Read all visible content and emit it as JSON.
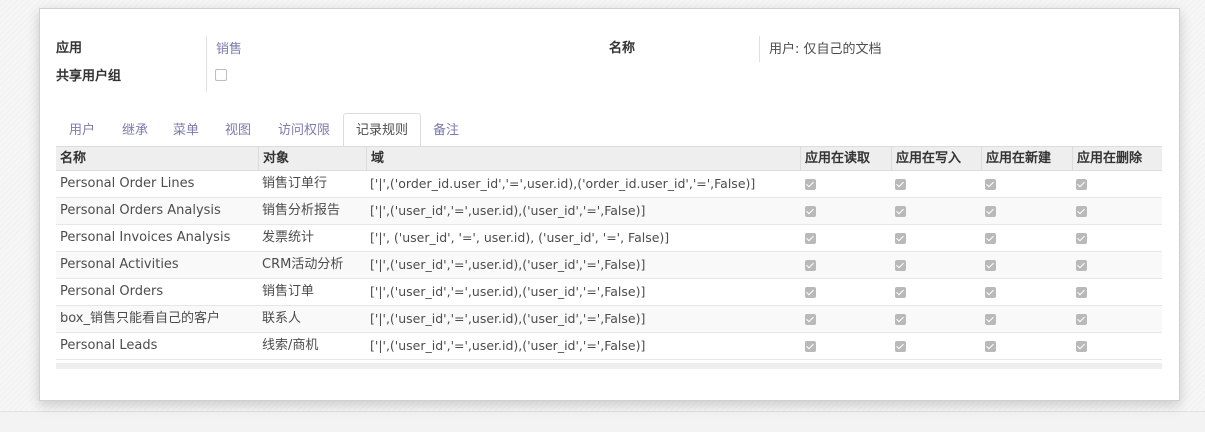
{
  "form": {
    "app_label": "应用",
    "app_value": "销售",
    "shared_label": "共享用户组",
    "name_label": "名称",
    "name_value": "用户: 仅自己的文档"
  },
  "tabs": [
    {
      "label": "用户",
      "active": false
    },
    {
      "label": "继承",
      "active": false
    },
    {
      "label": "菜单",
      "active": false
    },
    {
      "label": "视图",
      "active": false
    },
    {
      "label": "访问权限",
      "active": false
    },
    {
      "label": "记录规则",
      "active": true
    },
    {
      "label": "备注",
      "active": false
    }
  ],
  "table": {
    "headers": [
      "名称",
      "对象",
      "域",
      "应用在读取",
      "应用在写入",
      "应用在新建",
      "应用在删除"
    ],
    "rows": [
      {
        "name": "Personal Order Lines",
        "object": "销售订单行",
        "domain": "['|',('order_id.user_id','=',user.id),('order_id.user_id','=',False)]",
        "read": true,
        "write": true,
        "create": true,
        "unlink": true
      },
      {
        "name": "Personal Orders Analysis",
        "object": "销售分析报告",
        "domain": "['|',('user_id','=',user.id),('user_id','=',False)]",
        "read": true,
        "write": true,
        "create": true,
        "unlink": true
      },
      {
        "name": "Personal Invoices Analysis",
        "object": "发票统计",
        "domain": "['|', ('user_id', '=', user.id), ('user_id', '=', False)]",
        "read": true,
        "write": true,
        "create": true,
        "unlink": true
      },
      {
        "name": "Personal Activities",
        "object": "CRM活动分析",
        "domain": "['|',('user_id','=',user.id),('user_id','=',False)]",
        "read": true,
        "write": true,
        "create": true,
        "unlink": true
      },
      {
        "name": "Personal Orders",
        "object": "销售订单",
        "domain": "['|',('user_id','=',user.id),('user_id','=',False)]",
        "read": true,
        "write": true,
        "create": true,
        "unlink": true
      },
      {
        "name": "box_销售只能看自己的客户",
        "object": "联系人",
        "domain": "['|',('user_id','=',user.id),('user_id','=',False)]",
        "read": true,
        "write": true,
        "create": true,
        "unlink": true
      },
      {
        "name": "Personal Leads",
        "object": "线索/商机",
        "domain": "['|',('user_id','=',user.id),('user_id','=',False)]",
        "read": true,
        "write": true,
        "create": true,
        "unlink": true
      }
    ]
  }
}
